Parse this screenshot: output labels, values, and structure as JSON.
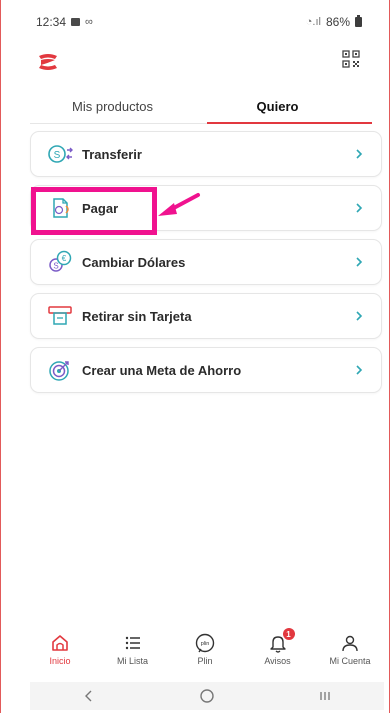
{
  "status": {
    "time": "12:34",
    "battery": "86%"
  },
  "tabs": [
    {
      "label": "Mis productos"
    },
    {
      "label": "Quiero"
    }
  ],
  "options": [
    {
      "label": "Transferir",
      "icon": "transfer-icon"
    },
    {
      "label": "Pagar",
      "icon": "pay-document-icon"
    },
    {
      "label": "Cambiar Dólares",
      "icon": "currency-exchange-icon"
    },
    {
      "label": "Retirar sin Tarjeta",
      "icon": "atm-withdraw-icon"
    },
    {
      "label": "Crear una Meta de Ahorro",
      "icon": "savings-target-icon"
    }
  ],
  "bottom_nav": [
    {
      "label": "Inicio",
      "icon": "home-icon",
      "active": true
    },
    {
      "label": "Mi Lista",
      "icon": "list-icon"
    },
    {
      "label": "Plin",
      "icon": "plin-icon"
    },
    {
      "label": "Avisos",
      "icon": "bell-icon",
      "badge": "1"
    },
    {
      "label": "Mi Cuenta",
      "icon": "user-icon"
    }
  ],
  "colors": {
    "brand_red": "#e2383f",
    "highlight_pink": "#f0128f",
    "icon_teal": "#2fa7b4",
    "icon_purple": "#7b5cc7"
  }
}
